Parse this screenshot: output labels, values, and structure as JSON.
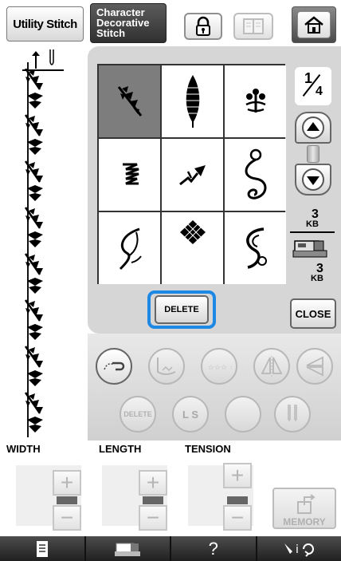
{
  "tabs": {
    "utility": "Utility Stitch",
    "character": [
      "Character",
      "Decorative",
      "Stitch"
    ]
  },
  "page": {
    "current": "1",
    "total": "4"
  },
  "memory_usage": {
    "top_value": "3",
    "top_unit": "KB",
    "bottom_value": "3",
    "bottom_unit": "KB"
  },
  "buttons": {
    "delete": "DELETE",
    "close": "CLOSE",
    "delete_small": "DELETE",
    "ls": "L S",
    "memory": "MEMORY"
  },
  "controls": {
    "width": "WIDTH",
    "length": "LENGTH",
    "tension": "TENSION"
  },
  "bottom_bar": {
    "help": "?"
  },
  "icons": {
    "lock": "lock-icon",
    "book": "book-icon",
    "home": "home-icon",
    "up": "up-arrow-icon",
    "down": "down-arrow-icon",
    "sewing_machine": "sewing-machine-icon",
    "memory": "memory-icon",
    "document": "document-icon",
    "settings": "settings-icon"
  },
  "colors": {
    "selection": "#1e88e5",
    "selected_cell": "#7d7d7d",
    "panel": "#d6d6d6"
  }
}
